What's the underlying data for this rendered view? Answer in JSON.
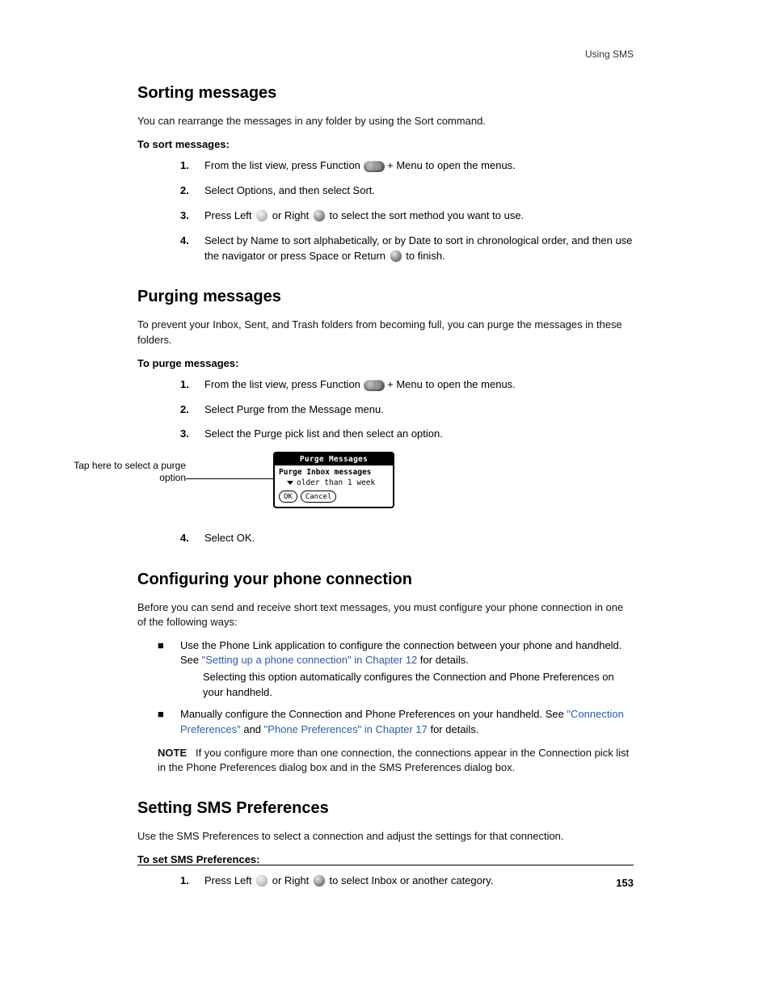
{
  "page": {
    "header_right": "Using SMS",
    "footer": "153"
  },
  "sections": {
    "sort": {
      "heading": "Sorting messages",
      "p1": "You can rearrange the messages in any folder by using the Sort command.",
      "steps_title": "To sort messages:",
      "s1_a": "1.",
      "s1_b": "From the list view, press Function ",
      "s1_c": " + Menu ",
      "s1_d": " to open the menus.",
      "s2": "Select Options, and then select Sort.",
      "s3_a": "Press Left ",
      "s3_b": " or Right ",
      "s3_c": " to select the sort method you want to use.",
      "s4_a": "Select by Name to sort alphabetically, or by Date to sort in chronological order, and then use the navigator or press Space or Return ",
      "s4_b": " to finish."
    },
    "purge": {
      "heading": "Purging messages",
      "p1": "To prevent your Inbox, Sent, and Trash folders from becoming full, you can purge the messages in these folders.",
      "steps_title": "To purge messages:",
      "s1_a": "1.",
      "s1_b": "From the list view, press Function ",
      "s1_c": " + Menu ",
      "s1_d": " to open the menus.",
      "s2": "Select Purge from the Message menu.",
      "s3": "Select the Purge pick list and then select an option.",
      "s4": "Select OK."
    },
    "dialog": {
      "title": "Purge Messages",
      "line1": "Purge Inbox messages",
      "pick_value": "older than 1 week",
      "ok": "OK",
      "cancel": "Cancel",
      "callout": "Tap here to select a purge option"
    },
    "config": {
      "heading": "Configuring your phone connection",
      "p1": "Before you can send and receive short text messages, you must configure your phone connection in one of the following ways:",
      "bullet1_a": "Use the Phone Link application to configure the connection between your phone and handheld. See ",
      "bullet1_link": "\"Setting up a phone connection\" in Chapter 12",
      "bullet1_b": " for details.",
      "bullet1_sub": "Selecting this option automatically configures the Connection and Phone Preferences on your handheld.",
      "bullet2_a": "Manually configure the Connection and Phone Preferences on your handheld. See ",
      "bullet2_link1": "\"Connection Preferences\"",
      "bullet2_mid": " and ",
      "bullet2_link2": "\"Phone Preferences\" in Chapter 17",
      "bullet2_b": " for details.",
      "note_label": "NOTE",
      "note_body": "If you configure more than one connection, the connections appear in the Connection pick list in the Phone Preferences dialog box and in the SMS Preferences dialog box."
    },
    "setprefs": {
      "heading": "Setting SMS Preferences",
      "p1": "Use the SMS Preferences to select a connection and adjust the settings for that connection.",
      "steps_title": "To set SMS Preferences:",
      "s1_a": "Press Left ",
      "s1_b": " or Right ",
      "s1_c": " to select Inbox or another category."
    }
  }
}
